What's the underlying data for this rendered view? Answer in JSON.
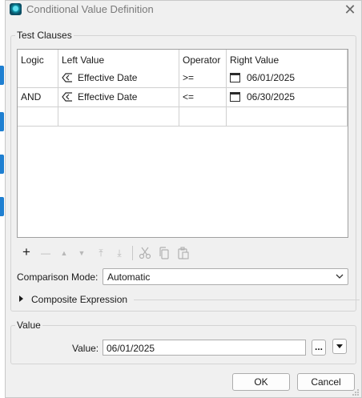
{
  "window": {
    "title": "Conditional Value Definition",
    "icon": "app-icon",
    "close_glyph": "✕"
  },
  "test_clauses": {
    "group_label": "Test Clauses",
    "columns": [
      "Logic",
      "Left Value",
      "Operator",
      "Right Value"
    ],
    "rows": [
      {
        "logic": "",
        "left_value": "Effective Date",
        "operator": ">=",
        "right_value": "06/01/2025"
      },
      {
        "logic": "AND",
        "left_value": "Effective Date",
        "operator": "<=",
        "right_value": "06/30/2025"
      },
      {
        "logic": "",
        "left_value": "",
        "operator": "",
        "right_value": ""
      }
    ]
  },
  "toolbar": {
    "add": "+",
    "remove": "—",
    "move_up": "▲",
    "move_down": "▼",
    "move_top": "⤒",
    "move_bottom": "⤓",
    "icons": [
      "plus-icon",
      "minus-icon",
      "move-up-icon",
      "move-down-icon",
      "move-top-icon",
      "move-bottom-icon",
      "cut-icon",
      "copy-icon",
      "paste-icon"
    ]
  },
  "comparison_mode": {
    "label": "Comparison Mode:",
    "value": "Automatic"
  },
  "composite_expression": {
    "label": "Composite Expression",
    "expanded": false
  },
  "value_group": {
    "group_label": "Value",
    "label": "Value:",
    "value": "06/01/2025",
    "browse_label": "..."
  },
  "buttons": {
    "ok": "OK",
    "cancel": "Cancel"
  },
  "colors": {
    "accent": "#1e7fd1",
    "grid_border": "#a0a0a0",
    "background": "#f0f0f0"
  }
}
